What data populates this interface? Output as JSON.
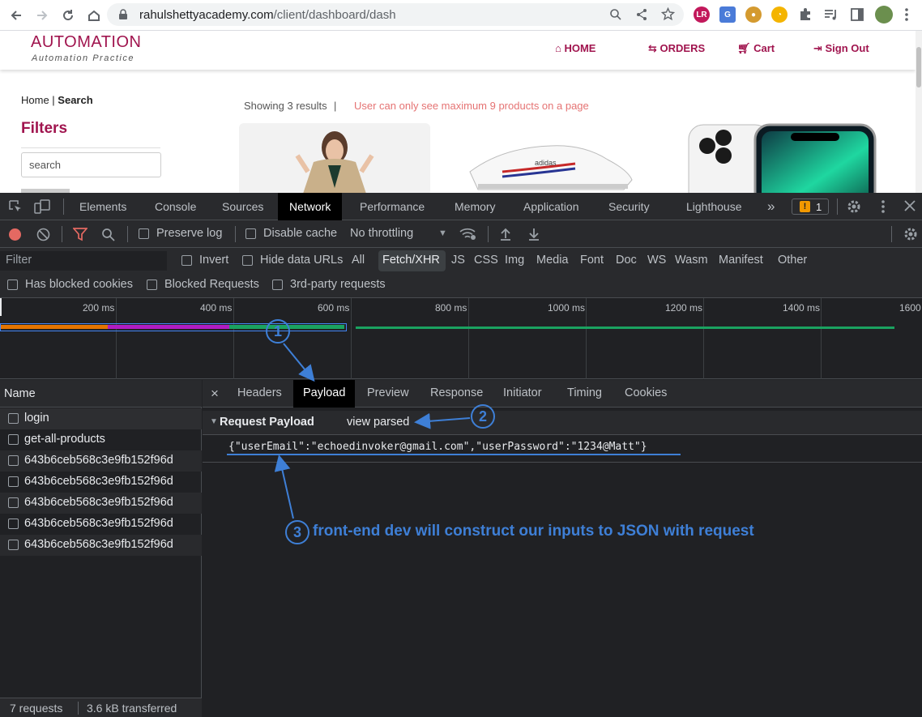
{
  "browser": {
    "url_host": "rahulshettyacademy.com",
    "url_path": "/client/dashboard/dash"
  },
  "site": {
    "logo_title": "AUTOMATION",
    "logo_subtitle": "Automation Practice",
    "nav": {
      "home": "HOME",
      "orders": "ORDERS",
      "cart": "Cart",
      "signout": "Sign Out"
    },
    "breadcrumb_home": "Home",
    "breadcrumb_sep": " | ",
    "breadcrumb_current": "Search",
    "filters_title": "Filters",
    "search_placeholder": "search",
    "showing": "Showing 3 results",
    "divider": "|",
    "limit_msg": "User can only see maximum 9 products on a page"
  },
  "devtools": {
    "tabs": [
      "Elements",
      "Console",
      "Sources",
      "Network",
      "Performance",
      "Memory",
      "Application",
      "Security",
      "Lighthouse"
    ],
    "active_tab": "Network",
    "more": "»",
    "issues_count": "1",
    "toolbar": {
      "preserve_log": "Preserve log",
      "disable_cache": "Disable cache",
      "throttling": "No throttling"
    },
    "filter": {
      "placeholder": "Filter",
      "invert": "Invert",
      "hide_data_urls": "Hide data URLs",
      "types": [
        "All",
        "Fetch/XHR",
        "JS",
        "CSS",
        "Img",
        "Media",
        "Font",
        "Doc",
        "WS",
        "Wasm",
        "Manifest",
        "Other"
      ],
      "active_type": "Fetch/XHR"
    },
    "blocked": {
      "has_blocked_cookies": "Has blocked cookies",
      "blocked_requests": "Blocked Requests",
      "third_party": "3rd-party requests"
    },
    "timeline_ticks": [
      "200 ms",
      "400 ms",
      "600 ms",
      "800 ms",
      "1000 ms",
      "1200 ms",
      "1400 ms",
      "1600"
    ],
    "list": {
      "header": "Name",
      "requests": [
        "login",
        "get-all-products",
        "643b6ceb568c3e9fb152f96d",
        "643b6ceb568c3e9fb152f96d",
        "643b6ceb568c3e9fb152f96d",
        "643b6ceb568c3e9fb152f96d",
        "643b6ceb568c3e9fb152f96d"
      ],
      "footer_requests": "7 requests",
      "footer_transferred": "3.6 kB transferred"
    },
    "detail": {
      "close": "×",
      "tabs": [
        "Headers",
        "Payload",
        "Preview",
        "Response",
        "Initiator",
        "Timing",
        "Cookies"
      ],
      "active_tab": "Payload",
      "section_title": "Request Payload",
      "view_parsed": "view parsed",
      "payload": "{\"userEmail\":\"echoedinvoker@gmail.com\",\"userPassword\":\"1234@Matt\"}"
    }
  },
  "annotations": {
    "marker1": "1",
    "marker2": "2",
    "marker3": "3",
    "note": "front-end dev will construct our inputs to JSON with request",
    "color": "#3e7fd6"
  }
}
